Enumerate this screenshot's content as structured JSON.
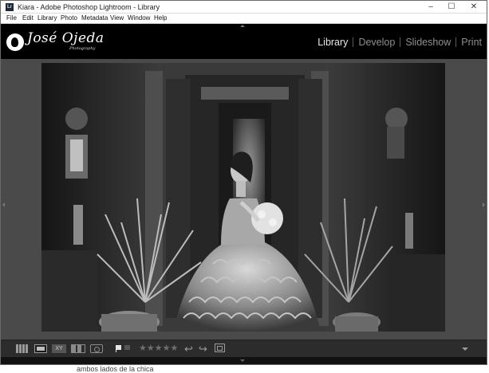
{
  "window": {
    "app_icon": "Lr",
    "title": "Kiara - Adobe Photoshop Lightroom - Library",
    "minimize": "–",
    "maximize": "☐",
    "close": "✕"
  },
  "menu": [
    "File",
    "Edit",
    "Library",
    "Photo",
    "Metadata",
    "View",
    "Window",
    "Help"
  ],
  "identity_plate": {
    "name": "José Ojeda",
    "sub": "Photography"
  },
  "modules": [
    {
      "label": "Library",
      "active": true
    },
    {
      "label": "Develop",
      "active": false
    },
    {
      "label": "Slideshow",
      "active": false
    },
    {
      "label": "Print",
      "active": false
    }
  ],
  "toolbar": {
    "compare_label": "XY",
    "stars": "★★★★★",
    "rotate_left": "↩",
    "rotate_right": "↪",
    "rating": 0
  },
  "photo": {
    "subject": "black and white photo of a girl in a ruffled gown holding a bouquet in a hallway"
  },
  "background_text": "ambos lados de la chica",
  "colors": {
    "panel_bg": "#1a1a1a",
    "view_bg": "#4a4a4a",
    "active_module": "#e8e8e8",
    "inactive_module": "#8f8f8f"
  }
}
